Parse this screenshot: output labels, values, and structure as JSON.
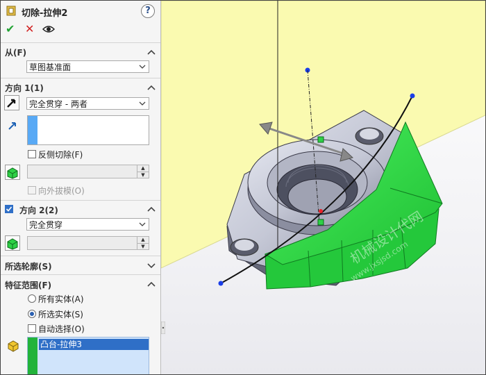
{
  "title": "切除-拉伸2",
  "help_label": "?",
  "actions": {
    "ok_glyph": "✔",
    "cancel_glyph": "✕",
    "preview": "eye-icon"
  },
  "from": {
    "header": "从(F)",
    "value": "草图基准面"
  },
  "direction1": {
    "header": "方向 1(1)",
    "end_condition": "完全贯穿 - 两者",
    "flip_side_label": "反侧切除(F)",
    "draft_outward_label": "向外拔模(O)"
  },
  "direction2": {
    "header": "方向 2(2)",
    "end_condition": "完全贯穿",
    "checked": true
  },
  "selected_contours": {
    "header": "所选轮廓(S)"
  },
  "feature_scope": {
    "header": "特征范围(F)",
    "options": [
      "所有实体(A)",
      "所选实体(S)"
    ],
    "selected_index": 1,
    "auto_select_label": "自动选择(O)",
    "bodies": [
      "凸台-拉伸3"
    ]
  },
  "watermark": {
    "line1": "机械设计代网",
    "line2": "www.jxsjsd.com"
  },
  "colors": {
    "accent": "#2f6fc7",
    "green_body": "#2ee84a",
    "plane": "#fafab0"
  }
}
